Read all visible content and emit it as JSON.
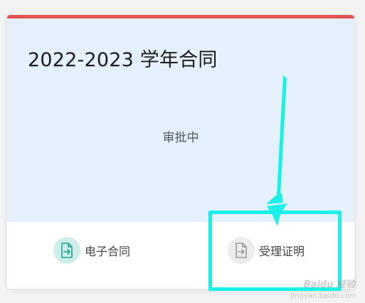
{
  "card": {
    "title": "2022-2023 学年合同",
    "status": "审批中",
    "accent_color": "#e25452",
    "top_background": "#e4f1fd"
  },
  "actions": [
    {
      "label": "电子合同",
      "icon": "document-arrow-icon",
      "icon_color": "#1aa08f"
    },
    {
      "label": "受理证明",
      "icon": "document-arrow-icon",
      "icon_color": "#9a9a9a"
    }
  ],
  "annotation": {
    "color": "#18f0e8"
  },
  "watermark": {
    "text": "Baidu 经验",
    "url": "jingyan.baidu.com"
  }
}
